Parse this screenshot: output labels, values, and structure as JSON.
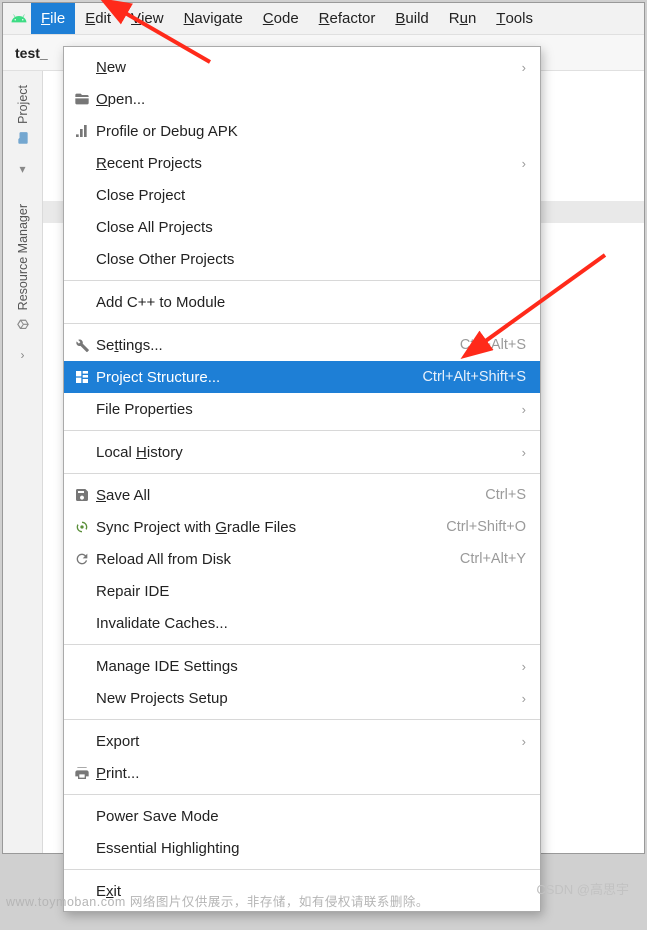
{
  "menubar": {
    "items": [
      {
        "label": "File",
        "mn": "F",
        "active": true
      },
      {
        "label": "Edit",
        "mn": "E"
      },
      {
        "label": "View",
        "mn": "V"
      },
      {
        "label": "Navigate",
        "mn": "N"
      },
      {
        "label": "Code",
        "mn": "C"
      },
      {
        "label": "Refactor",
        "mn": "R"
      },
      {
        "label": "Build",
        "mn": "B"
      },
      {
        "label": "Run",
        "mn": "u"
      },
      {
        "label": "Tools",
        "mn": "T"
      }
    ]
  },
  "breadcrumb": {
    "project": "test_"
  },
  "side_tabs": {
    "project": "Project",
    "resource_manager": "Resource Manager"
  },
  "file_menu": {
    "groups": [
      [
        {
          "label": "New",
          "mn": "N",
          "submenu": true
        },
        {
          "label": "Open...",
          "mn": "O",
          "icon": "folder-open-icon"
        },
        {
          "label": "Profile or Debug APK",
          "icon": "profile-icon"
        },
        {
          "label": "Recent Projects",
          "mn": "R",
          "submenu": true
        },
        {
          "label": "Close Project"
        },
        {
          "label": "Close All Projects"
        },
        {
          "label": "Close Other Projects"
        }
      ],
      [
        {
          "label": "Add C++ to Module"
        }
      ],
      [
        {
          "label": "Settings...",
          "mn": "t",
          "icon": "wrench-icon",
          "shortcut": "Ctrl+Alt+S"
        },
        {
          "label": "Project Structure...",
          "mn": "",
          "icon": "project-structure-icon",
          "shortcut": "Ctrl+Alt+Shift+S",
          "selected": true
        },
        {
          "label": "File Properties",
          "submenu": true
        }
      ],
      [
        {
          "label": "Local History",
          "mn": "H",
          "submenu": true
        }
      ],
      [
        {
          "label": "Save All",
          "mn": "S",
          "icon": "save-icon",
          "shortcut": "Ctrl+S"
        },
        {
          "label": "Sync Project with Gradle Files",
          "mn": "G",
          "icon": "sync-gradle-icon",
          "shortcut": "Ctrl+Shift+O"
        },
        {
          "label": "Reload All from Disk",
          "icon": "reload-icon",
          "shortcut": "Ctrl+Alt+Y"
        },
        {
          "label": "Repair IDE"
        },
        {
          "label": "Invalidate Caches..."
        }
      ],
      [
        {
          "label": "Manage IDE Settings",
          "submenu": true
        },
        {
          "label": "New Projects Setup",
          "submenu": true
        }
      ],
      [
        {
          "label": "Export",
          "submenu": true
        },
        {
          "label": "Print...",
          "mn": "P",
          "icon": "print-icon"
        }
      ],
      [
        {
          "label": "Power Save Mode"
        },
        {
          "label": "Essential Highlighting"
        }
      ],
      [
        {
          "label": "Exit",
          "mn": "x"
        }
      ]
    ]
  },
  "watermarks": {
    "left": "www.toymoban.com  网络图片仅供展示，非存储，如有侵权请联系删除。",
    "right": "CSDN @高思宇"
  }
}
